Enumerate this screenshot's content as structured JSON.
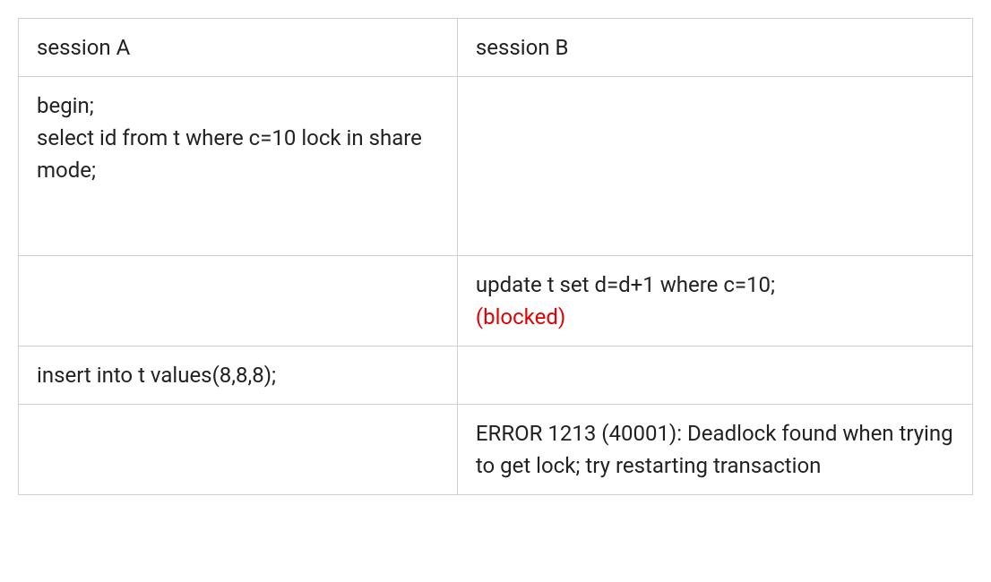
{
  "table": {
    "headers": {
      "colA": "session A",
      "colB": "session B"
    },
    "rows": [
      {
        "a": {
          "lines": [
            "begin;",
            "select id from t where c=10 lock in share mode;"
          ]
        },
        "b": {
          "lines": []
        }
      },
      {
        "a": {
          "lines": []
        },
        "b": {
          "lines": [
            "update t set d=d+1 where c=10;"
          ],
          "status": "(blocked)"
        }
      },
      {
        "a": {
          "lines": [
            "insert into t values(8,8,8);"
          ]
        },
        "b": {
          "lines": []
        }
      },
      {
        "a": {
          "lines": []
        },
        "b": {
          "lines": [
            "ERROR 1213 (40001): Deadlock found when trying to get lock; try restarting transaction"
          ]
        }
      }
    ]
  }
}
